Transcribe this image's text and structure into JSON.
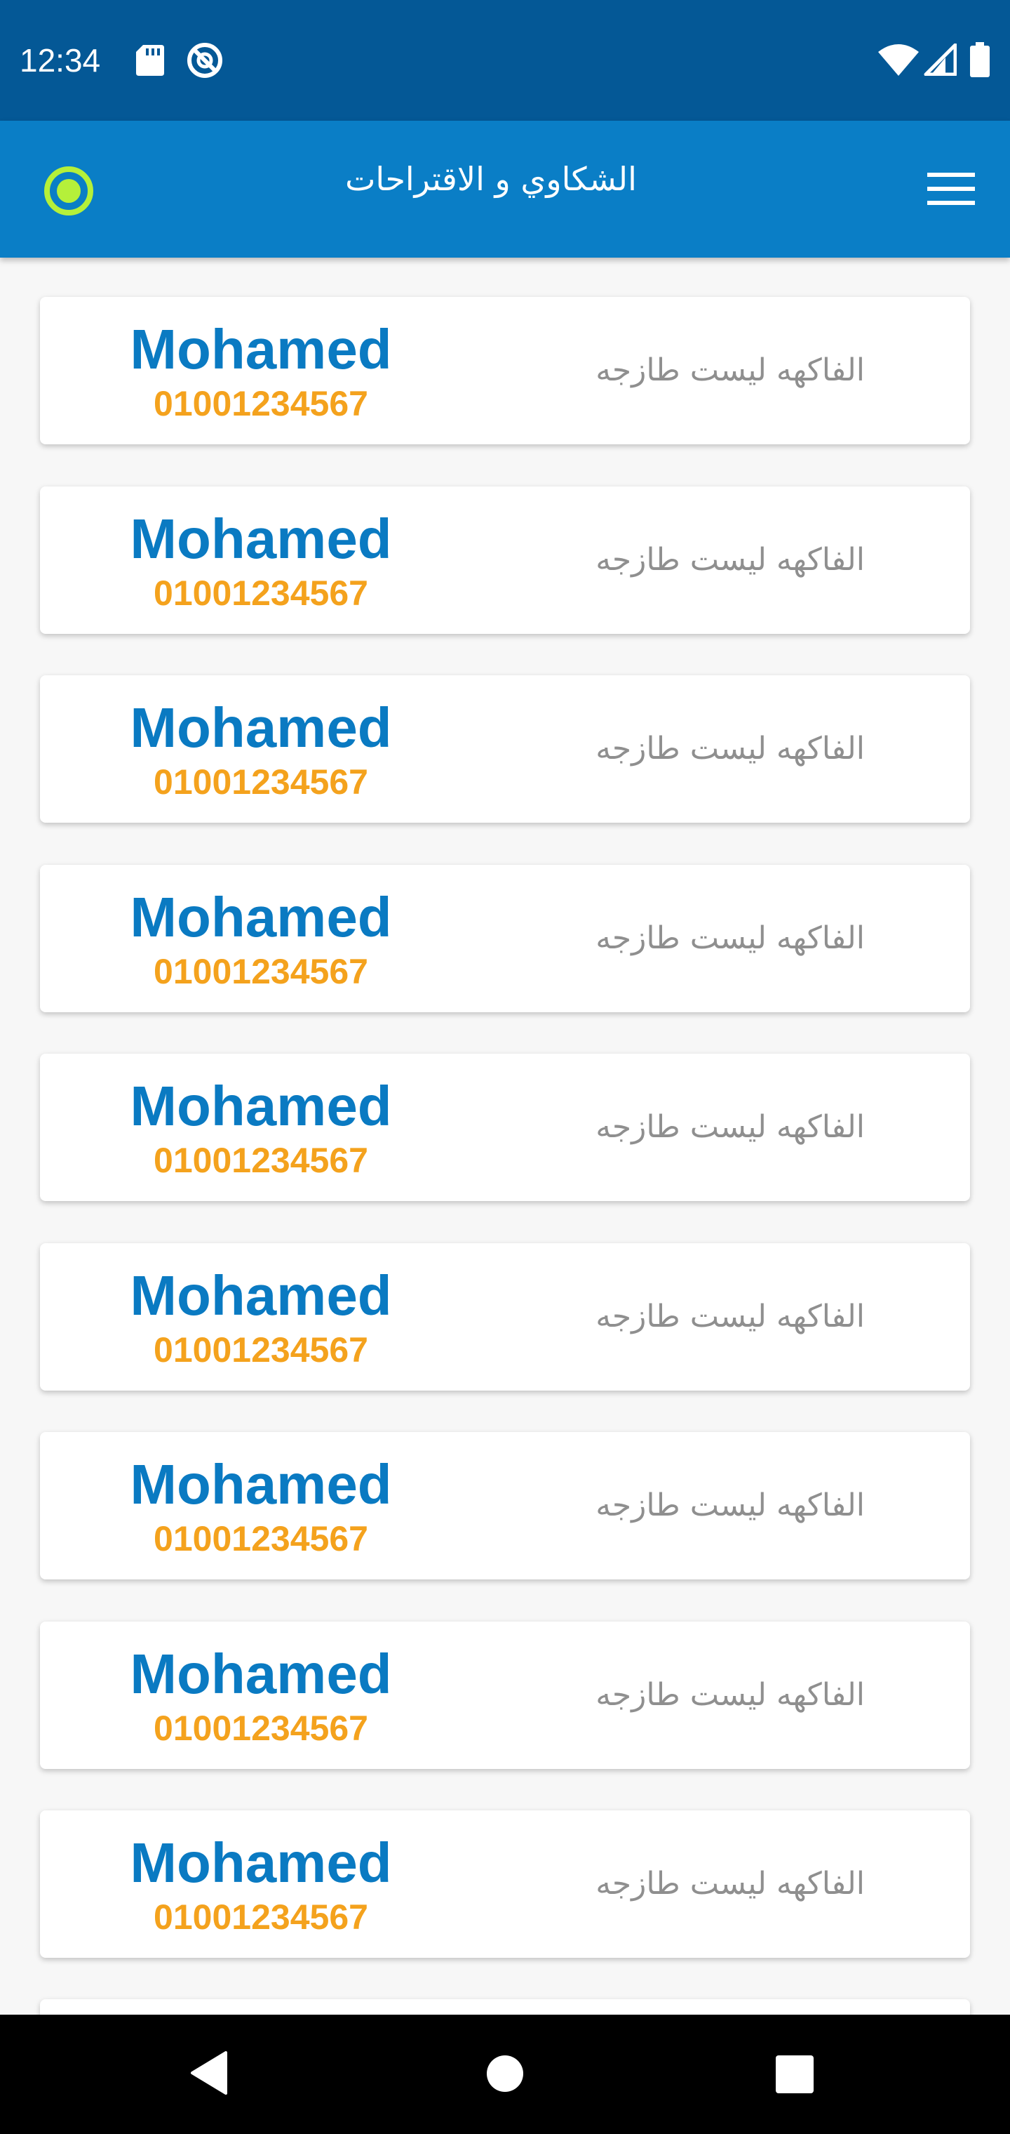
{
  "status_bar": {
    "time": "12:34",
    "icons": [
      "sd-card-icon",
      "sync-icon",
      "wifi-icon",
      "signal-icon",
      "battery-icon"
    ]
  },
  "app_bar": {
    "title": "الشكاوي و الاقتراحات",
    "left_icon": "record-icon",
    "right_icon": "menu-icon",
    "accent": "#b5f03a"
  },
  "complaints": [
    {
      "name": "Mohamed",
      "phone": "01001234567",
      "text": "الفاكهه ليست طازجه"
    },
    {
      "name": "Mohamed",
      "phone": "01001234567",
      "text": "الفاكهه ليست طازجه"
    },
    {
      "name": "Mohamed",
      "phone": "01001234567",
      "text": "الفاكهه ليست طازجه"
    },
    {
      "name": "Mohamed",
      "phone": "01001234567",
      "text": "الفاكهه ليست طازجه"
    },
    {
      "name": "Mohamed",
      "phone": "01001234567",
      "text": "الفاكهه ليست طازجه"
    },
    {
      "name": "Mohamed",
      "phone": "01001234567",
      "text": "الفاكهه ليست طازجه"
    },
    {
      "name": "Mohamed",
      "phone": "01001234567",
      "text": "الفاكهه ليست طازجه"
    },
    {
      "name": "Mohamed",
      "phone": "01001234567",
      "text": "الفاكهه ليست طازجه"
    },
    {
      "name": "Mohamed",
      "phone": "01001234567",
      "text": "الفاكهه ليست طازجه"
    }
  ],
  "colors": {
    "status_bar": "#045896",
    "app_bar": "#0a7ec6",
    "name": "#0a7ac2",
    "phone": "#f4a21d",
    "complaint_text": "#8f8f8f"
  },
  "nav_bar": {
    "icons": [
      "back-icon",
      "home-icon",
      "recents-icon"
    ]
  }
}
